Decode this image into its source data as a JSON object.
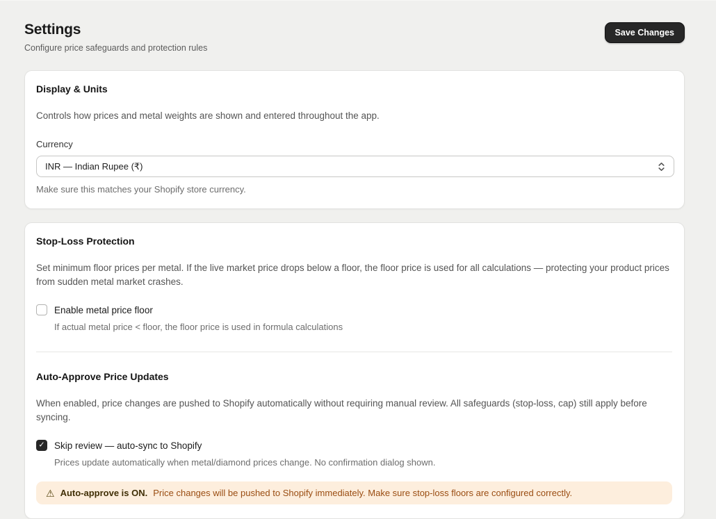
{
  "page": {
    "title": "Settings",
    "subtitle": "Configure price safeguards and protection rules",
    "save_button_label": "Save Changes"
  },
  "display_units": {
    "heading": "Display & Units",
    "description": "Controls how prices and metal weights are shown and entered throughout the app.",
    "currency": {
      "label": "Currency",
      "selected_value": "INR — Indian Rupee (₹)",
      "help": "Make sure this matches your Shopify store currency."
    }
  },
  "stop_loss": {
    "heading": "Stop-Loss Protection",
    "description": "Set minimum floor prices per metal. If the live market price drops below a floor, the floor price is used for all calculations — protecting your product prices from sudden metal market crashes.",
    "checkbox": {
      "label": "Enable metal price floor",
      "checked": false,
      "help": "If actual metal price < floor, the floor price is used in formula calculations"
    }
  },
  "auto_approve": {
    "heading": "Auto-Approve Price Updates",
    "description": "When enabled, price changes are pushed to Shopify automatically without requiring manual review. All safeguards (stop-loss, cap) still apply before syncing.",
    "checkbox": {
      "label": "Skip review — auto-sync to Shopify",
      "checked": true,
      "help": "Prices update automatically when metal/diamond prices change. No confirmation dialog shown."
    },
    "warning": {
      "icon_glyph": "⚠",
      "bold_text": "Auto-approve is ON.",
      "text": "Price changes will be pushed to Shopify immediately. Make sure stop-loss floors are configured correctly.",
      "background_color": "#fdeedd",
      "text_color": "#9a4d12"
    }
  },
  "icons": {
    "checkmark": "✓"
  }
}
